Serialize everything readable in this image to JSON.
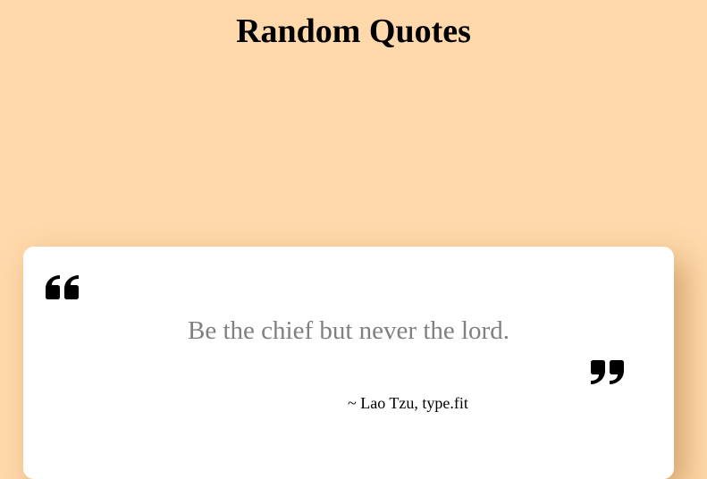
{
  "header": {
    "title": "Random Quotes"
  },
  "quote": {
    "text": "Be the chief but never the lord.",
    "author": "~ Lao Tzu, type.fit",
    "open_icon": "quote-left-icon",
    "close_icon": "quote-right-icon"
  },
  "colors": {
    "background": "#FFD8AB",
    "card": "#FFFFFF",
    "quote_text": "#808080",
    "icon": "#000000"
  }
}
